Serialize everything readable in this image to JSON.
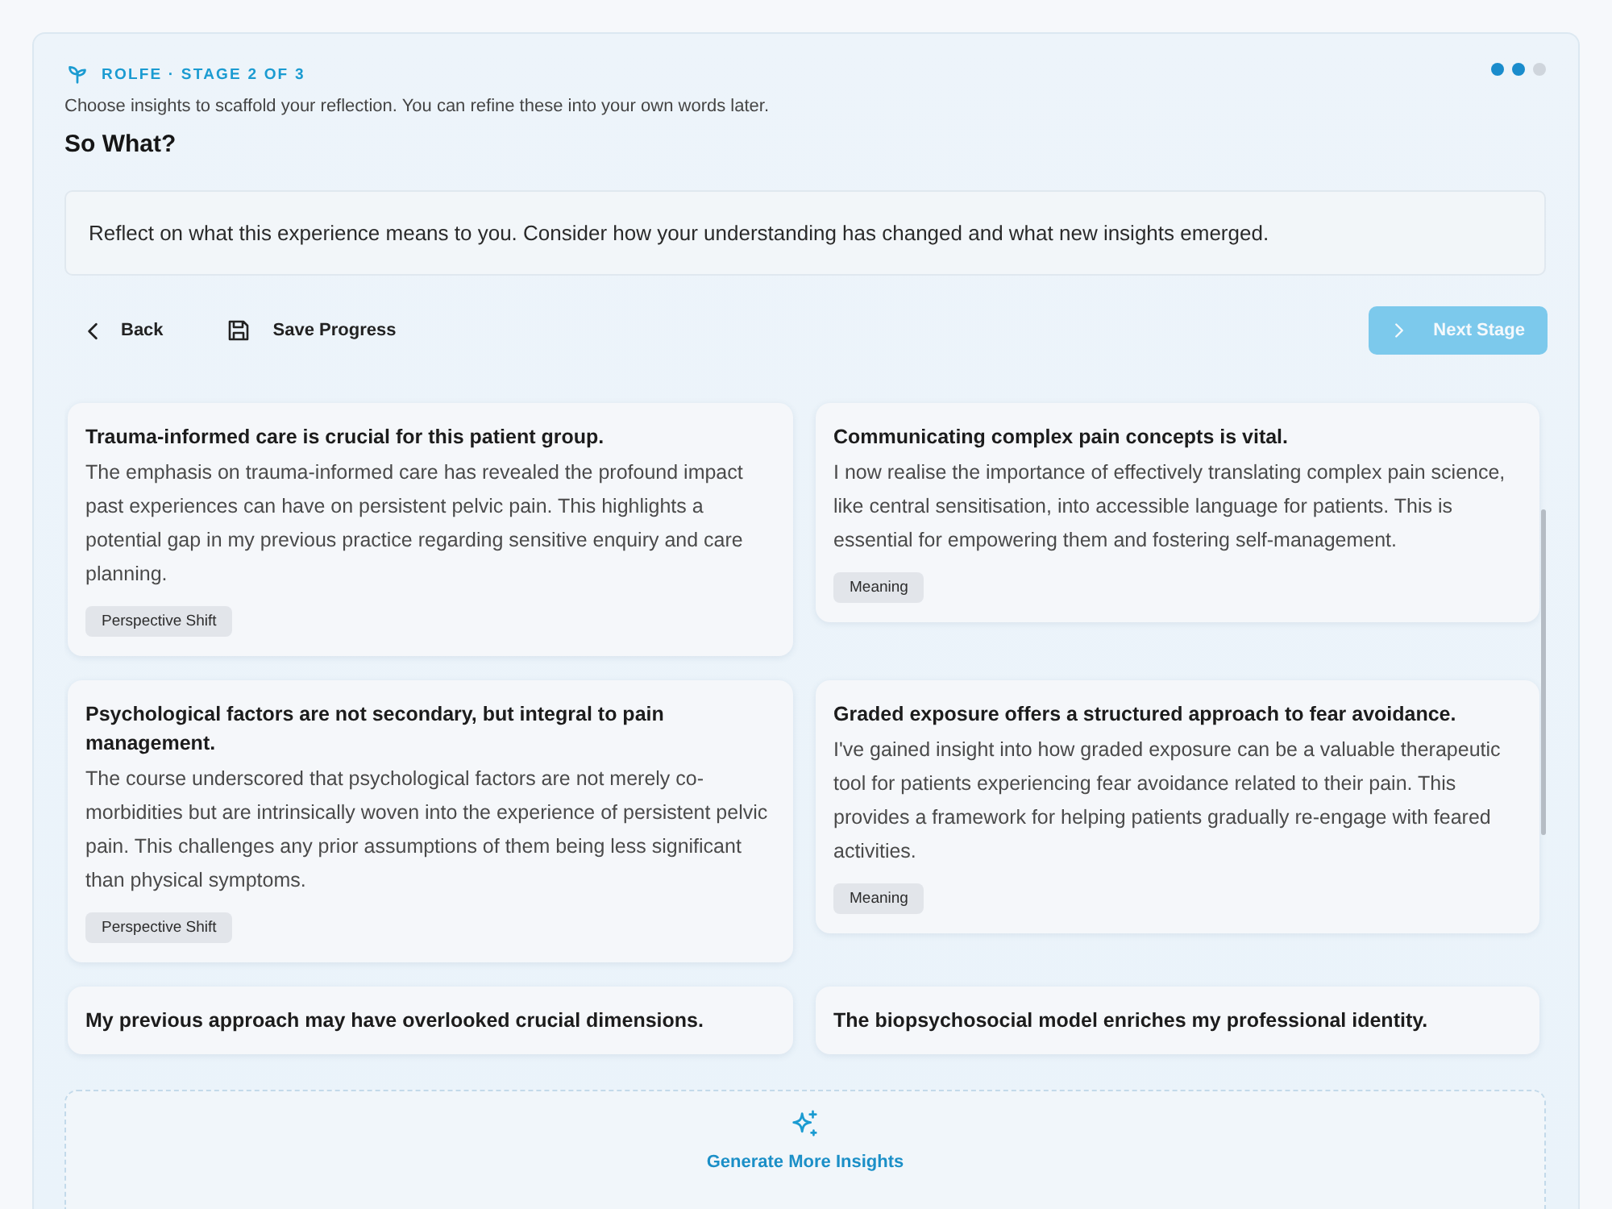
{
  "header": {
    "eyebrow": "ROLFE · STAGE 2 OF 3",
    "instructions": "Choose insights to scaffold your reflection. You can refine these into your own words later.",
    "title": "So What?"
  },
  "progress_dots": [
    {
      "completed": true
    },
    {
      "completed": true
    },
    {
      "completed": false
    }
  ],
  "prompt": "Reflect on what this experience means to you. Consider how your understanding has changed and what new insights emerged.",
  "actions": {
    "back": {
      "label": "Back"
    },
    "save": {
      "label": "Save Progress"
    },
    "next": {
      "label": "Next Stage",
      "disabled": true
    }
  },
  "insights": [
    {
      "title": "Trauma-informed care is crucial for this patient group.",
      "body": "The emphasis on trauma-informed care has revealed the profound impact past experiences can have on persistent pelvic pain. This highlights a potential gap in my previous practice regarding sensitive enquiry and care planning.",
      "tag": "Perspective Shift"
    },
    {
      "title": "Communicating complex pain concepts is vital.",
      "body": "I now realise the importance of effectively translating complex pain science, like central sensitisation, into accessible language for patients. This is essential for empowering them and fostering self-management.",
      "tag": "Meaning"
    },
    {
      "title": "Psychological factors are not secondary, but integral to pain management.",
      "body": "The course underscored that psychological factors are not merely co-morbidities but are intrinsically woven into the experience of persistent pelvic pain. This challenges any prior assumptions of them being less significant than physical symptoms.",
      "tag": "Perspective Shift"
    },
    {
      "title": "Graded exposure offers a structured approach to fear avoidance.",
      "body": "I've gained insight into how graded exposure can be a valuable therapeutic tool for patients experiencing fear avoidance related to their pain. This provides a framework for helping patients gradually re-engage with feared activities.",
      "tag": "Meaning"
    },
    {
      "title": "My previous approach may have overlooked crucial dimensions."
    },
    {
      "title": "The biopsychosocial model enriches my professional identity."
    }
  ],
  "generate": {
    "label": "Generate More Insights"
  }
}
